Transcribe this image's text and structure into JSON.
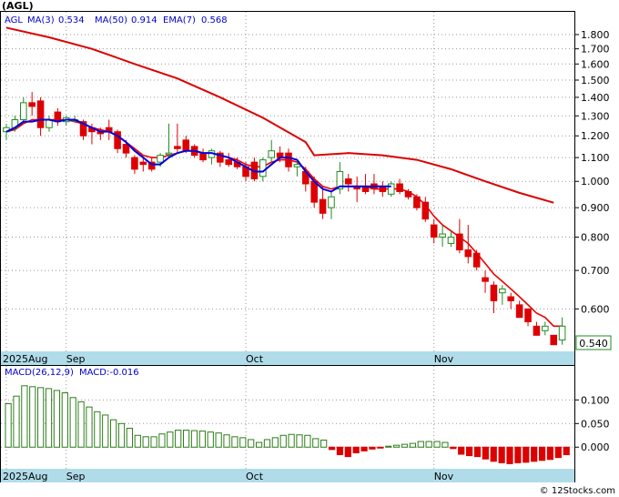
{
  "title": "(AGL)",
  "legend": {
    "ticker": "AGL",
    "ma3": "MA(3)",
    "ma3_value": "0.534",
    "ma50": "MA(50)",
    "ma50_value": "0.914",
    "ema7": "EMA(7)",
    "ema7_value": "0.568"
  },
  "macd_legend": {
    "label": "MACD(26,12,9)",
    "value": "MACD:-0.016"
  },
  "last_price_label": "0.540",
  "watermark": "© 12Stocks.com",
  "colors": {
    "up": "#228b22",
    "down": "#dd0000",
    "ma3": "#0000dd",
    "ma50": "#dd0000",
    "ema7": "#ee0000",
    "axis_bar": "#b0dcea",
    "macd_pos": "#2e7d1a",
    "macd_neg": "#dd0000",
    "legend_text": "#0000cc"
  },
  "chart_data": [
    {
      "type": "candlestick",
      "scale": "log",
      "y_ticks": [
        "0.600",
        "0.700",
        "0.800",
        "0.900",
        "1.000",
        "1.100",
        "1.200",
        "1.300",
        "1.400",
        "1.500",
        "1.600",
        "1.700",
        "1.800"
      ],
      "ylim": [
        0.51,
        1.95
      ],
      "x_labels": [
        {
          "index": 0,
          "label": "2025Aug"
        },
        {
          "index": 7,
          "label": "Sep"
        },
        {
          "index": 28,
          "label": "Oct"
        },
        {
          "index": 50,
          "label": "Nov"
        }
      ],
      "candles": [
        [
          1.22,
          1.26,
          1.18,
          1.24
        ],
        [
          1.24,
          1.3,
          1.22,
          1.28
        ],
        [
          1.28,
          1.4,
          1.26,
          1.37
        ],
        [
          1.37,
          1.43,
          1.3,
          1.35
        ],
        [
          1.38,
          1.4,
          1.2,
          1.24
        ],
        [
          1.24,
          1.3,
          1.22,
          1.28
        ],
        [
          1.32,
          1.34,
          1.25,
          1.27
        ],
        [
          1.27,
          1.3,
          1.25,
          1.29
        ],
        [
          1.28,
          1.3,
          1.27,
          1.28
        ],
        [
          1.27,
          1.28,
          1.18,
          1.2
        ],
        [
          1.24,
          1.26,
          1.16,
          1.22
        ],
        [
          1.22,
          1.24,
          1.18,
          1.21
        ],
        [
          1.24,
          1.28,
          1.18,
          1.22
        ],
        [
          1.22,
          1.23,
          1.12,
          1.14
        ],
        [
          1.16,
          1.18,
          1.1,
          1.12
        ],
        [
          1.1,
          1.11,
          1.03,
          1.05
        ],
        [
          1.08,
          1.1,
          1.04,
          1.07
        ],
        [
          1.08,
          1.1,
          1.04,
          1.05
        ],
        [
          1.08,
          1.12,
          1.06,
          1.11
        ],
        [
          1.12,
          1.26,
          1.1,
          1.12
        ],
        [
          1.15,
          1.26,
          1.12,
          1.14
        ],
        [
          1.18,
          1.2,
          1.12,
          1.13
        ],
        [
          1.15,
          1.16,
          1.1,
          1.11
        ],
        [
          1.12,
          1.14,
          1.08,
          1.09
        ],
        [
          1.1,
          1.14,
          1.07,
          1.13
        ],
        [
          1.12,
          1.13,
          1.06,
          1.08
        ],
        [
          1.09,
          1.12,
          1.06,
          1.07
        ],
        [
          1.08,
          1.1,
          1.05,
          1.06
        ],
        [
          1.06,
          1.08,
          1.0,
          1.02
        ],
        [
          1.08,
          1.1,
          1.0,
          1.01
        ],
        [
          1.02,
          1.1,
          1.0,
          1.09
        ],
        [
          1.1,
          1.18,
          1.08,
          1.13
        ],
        [
          1.12,
          1.15,
          1.08,
          1.1
        ],
        [
          1.12,
          1.14,
          1.04,
          1.06
        ],
        [
          1.06,
          1.08,
          1.02,
          1.07
        ],
        [
          1.04,
          1.06,
          0.96,
          0.99
        ],
        [
          1.0,
          1.02,
          0.9,
          0.92
        ],
        [
          0.93,
          0.98,
          0.86,
          0.88
        ],
        [
          0.9,
          0.96,
          0.86,
          0.94
        ],
        [
          0.97,
          1.08,
          0.95,
          1.04
        ],
        [
          1.01,
          1.03,
          0.96,
          0.99
        ],
        [
          0.98,
          1.02,
          0.92,
          0.97
        ],
        [
          0.98,
          1.03,
          0.95,
          0.96
        ],
        [
          0.99,
          1.03,
          0.95,
          0.97
        ],
        [
          0.98,
          1.0,
          0.94,
          0.96
        ],
        [
          0.95,
          1.0,
          0.94,
          0.99
        ],
        [
          0.99,
          1.01,
          0.95,
          0.96
        ],
        [
          0.96,
          0.97,
          0.93,
          0.94
        ],
        [
          0.94,
          0.95,
          0.89,
          0.9
        ],
        [
          0.92,
          0.94,
          0.85,
          0.86
        ],
        [
          0.84,
          0.86,
          0.78,
          0.8
        ],
        [
          0.8,
          0.84,
          0.77,
          0.81
        ],
        [
          0.78,
          0.82,
          0.77,
          0.8
        ],
        [
          0.81,
          0.86,
          0.75,
          0.76
        ],
        [
          0.76,
          0.84,
          0.72,
          0.74
        ],
        [
          0.75,
          0.76,
          0.7,
          0.71
        ],
        [
          0.68,
          0.7,
          0.64,
          0.67
        ],
        [
          0.66,
          0.67,
          0.59,
          0.62
        ],
        [
          0.64,
          0.66,
          0.61,
          0.65
        ],
        [
          0.63,
          0.64,
          0.6,
          0.62
        ],
        [
          0.61,
          0.62,
          0.58,
          0.58
        ],
        [
          0.6,
          0.6,
          0.56,
          0.57
        ],
        [
          0.56,
          0.57,
          0.54,
          0.54
        ],
        [
          0.55,
          0.57,
          0.54,
          0.56
        ],
        [
          0.54,
          0.54,
          0.52,
          0.52
        ],
        [
          0.53,
          0.58,
          0.52,
          0.56
        ]
      ],
      "ma3": [
        1.22,
        1.24,
        1.27,
        1.27,
        1.28,
        1.28,
        1.27,
        1.28,
        1.28,
        1.26,
        1.24,
        1.22,
        1.22,
        1.2,
        1.17,
        1.13,
        1.1,
        1.07,
        1.07,
        1.1,
        1.12,
        1.13,
        1.13,
        1.12,
        1.12,
        1.11,
        1.1,
        1.08,
        1.06,
        1.04,
        1.04,
        1.07,
        1.1,
        1.1,
        1.09,
        1.04,
        1.0,
        0.97,
        0.96,
        0.98,
        0.98,
        0.98,
        0.98,
        0.98,
        0.98,
        0.98
      ],
      "ma50": [
        [
          0,
          1.85
        ],
        [
          5,
          1.78
        ],
        [
          10,
          1.7
        ],
        [
          15,
          1.6
        ],
        [
          20,
          1.51
        ],
        [
          25,
          1.4
        ],
        [
          30,
          1.29
        ],
        [
          35,
          1.17
        ],
        [
          36,
          1.11
        ],
        [
          40,
          1.12
        ],
        [
          44,
          1.11
        ],
        [
          48,
          1.09
        ],
        [
          52,
          1.05
        ],
        [
          56,
          1.0
        ],
        [
          60,
          0.955
        ],
        [
          64,
          0.918
        ]
      ],
      "ema7": [
        1.22,
        1.23,
        1.26,
        1.28,
        1.28,
        1.28,
        1.28,
        1.28,
        1.27,
        1.26,
        1.24,
        1.23,
        1.22,
        1.2,
        1.17,
        1.14,
        1.11,
        1.1,
        1.1,
        1.11,
        1.12,
        1.13,
        1.13,
        1.12,
        1.12,
        1.11,
        1.1,
        1.09,
        1.07,
        1.06,
        1.06,
        1.08,
        1.09,
        1.09,
        1.08,
        1.05,
        1.01,
        0.98,
        0.97,
        0.98,
        0.98,
        0.98,
        0.98,
        0.97,
        0.97,
        0.97,
        0.97,
        0.96,
        0.94,
        0.91,
        0.87,
        0.84,
        0.82,
        0.8,
        0.78,
        0.75,
        0.72,
        0.69,
        0.67,
        0.65,
        0.63,
        0.61,
        0.59,
        0.58,
        0.56,
        0.56
      ]
    },
    {
      "type": "bar",
      "title": "MACD(26,12,9)",
      "y_ticks": [
        "0.100",
        "0.050",
        "0.000"
      ],
      "ylim": [
        -0.04,
        0.145
      ],
      "values": [
        0.092,
        0.108,
        0.13,
        0.128,
        0.126,
        0.124,
        0.12,
        0.115,
        0.105,
        0.096,
        0.085,
        0.075,
        0.068,
        0.058,
        0.05,
        0.04,
        0.025,
        0.022,
        0.022,
        0.028,
        0.032,
        0.036,
        0.036,
        0.035,
        0.034,
        0.032,
        0.03,
        0.026,
        0.022,
        0.02,
        0.016,
        0.01,
        0.016,
        0.02,
        0.025,
        0.027,
        0.026,
        0.025,
        0.018,
        0.015,
        -0.005,
        -0.016,
        -0.02,
        -0.012,
        -0.008,
        -0.004,
        -0.002,
        0.002,
        0.004,
        0.006,
        0.008,
        0.012,
        0.012,
        0.012,
        0.01,
        -0.003,
        -0.015,
        -0.018,
        -0.02,
        -0.025,
        -0.03,
        -0.033,
        -0.035,
        -0.033,
        -0.032,
        -0.03,
        -0.028,
        -0.026,
        -0.022,
        -0.016
      ],
      "x_labels": [
        {
          "index": 0,
          "label": "2025Aug"
        },
        {
          "index": 7,
          "label": "Sep"
        },
        {
          "index": 28,
          "label": "Oct"
        },
        {
          "index": 50,
          "label": "Nov"
        }
      ]
    }
  ]
}
